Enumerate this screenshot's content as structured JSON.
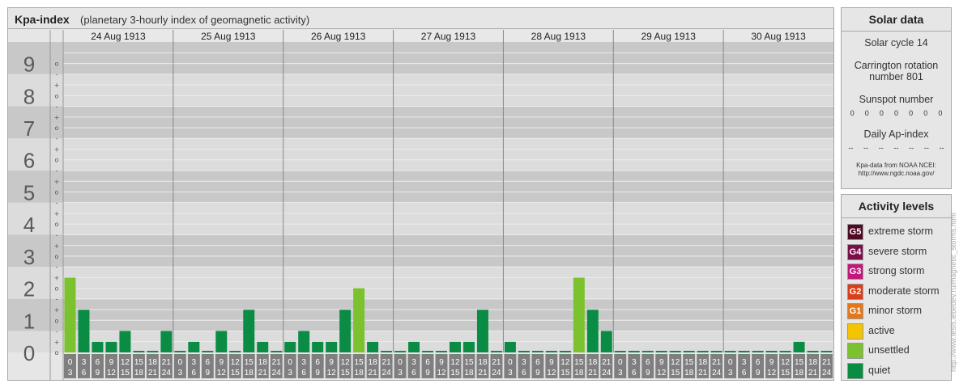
{
  "main": {
    "title": "Kpa-index",
    "subtitle": "(planetary 3-hourly index of geomagnetic activity)"
  },
  "solar": {
    "heading": "Solar data",
    "cycle": "Solar cycle 14",
    "carrington_line1": "Carrington rotation",
    "carrington_line2": "number 801",
    "sunspot_label": "Sunspot number",
    "sunspot_values": [
      "0",
      "0",
      "0",
      "0",
      "0",
      "0",
      "0"
    ],
    "ap_label": "Daily Ap-index",
    "ap_values": [
      "--",
      "--",
      "--",
      "--",
      "--",
      "--",
      "--"
    ],
    "source_line1": "Kpa-data from NOAA NCEI:",
    "source_line2": "http://www.ngdc.noaa.gov/"
  },
  "activity": {
    "heading": "Activity levels",
    "levels": [
      {
        "badge": "G5",
        "label": "extreme storm",
        "color": "#4d0a22"
      },
      {
        "badge": "G4",
        "label": "severe storm",
        "color": "#7a0f4a"
      },
      {
        "badge": "G3",
        "label": "strong storm",
        "color": "#c0197a"
      },
      {
        "badge": "G2",
        "label": "moderate storm",
        "color": "#d9401a"
      },
      {
        "badge": "G1",
        "label": "minor storm",
        "color": "#e2781b"
      },
      {
        "badge": "",
        "label": "active",
        "color": "#f5c400"
      },
      {
        "badge": "",
        "label": "unsettled",
        "color": "#7cc22e"
      },
      {
        "badge": "",
        "label": "quiet",
        "color": "#0a8c45"
      }
    ]
  },
  "watermark": "http://www.tesis.lebedev.ru/magnetic_storms.html",
  "chart_data": {
    "type": "bar",
    "y_ticks": [
      "0",
      "1",
      "2",
      "3",
      "4",
      "5",
      "6",
      "7",
      "8",
      "9"
    ],
    "sub_tick_labels": [
      "-",
      "o",
      "+"
    ],
    "days": [
      "24 Aug 1913",
      "25 Aug 1913",
      "26 Aug 1913",
      "27 Aug 1913",
      "28 Aug 1913",
      "29 Aug 1913",
      "30 Aug 1913"
    ],
    "interval_labels": [
      [
        "0",
        "3"
      ],
      [
        "3",
        "6"
      ],
      [
        "6",
        "9"
      ],
      [
        "9",
        "12"
      ],
      [
        "12",
        "15"
      ],
      [
        "15",
        "18"
      ],
      [
        "18",
        "21"
      ],
      [
        "21",
        "24"
      ]
    ],
    "ylim": [
      0,
      9.67
    ],
    "colors": {
      "quiet": "#0a8c45",
      "unsettled": "#7cc22e"
    },
    "values": [
      [
        2.33,
        1.33,
        0.33,
        0.33,
        0.67,
        0,
        0,
        0.67
      ],
      [
        0,
        0.33,
        0,
        0.67,
        0,
        1.33,
        0.33,
        0
      ],
      [
        0.33,
        0.67,
        0.33,
        0.33,
        1.33,
        2.0,
        0.33,
        0
      ],
      [
        0,
        0.33,
        0,
        0,
        0.33,
        0.33,
        1.33,
        0
      ],
      [
        0.33,
        0,
        0,
        0,
        0,
        2.33,
        1.33,
        0.67
      ],
      [
        0,
        0,
        0,
        0,
        0,
        0,
        0,
        0
      ],
      [
        0,
        0,
        0,
        0,
        0,
        0.33,
        0,
        0
      ]
    ]
  }
}
